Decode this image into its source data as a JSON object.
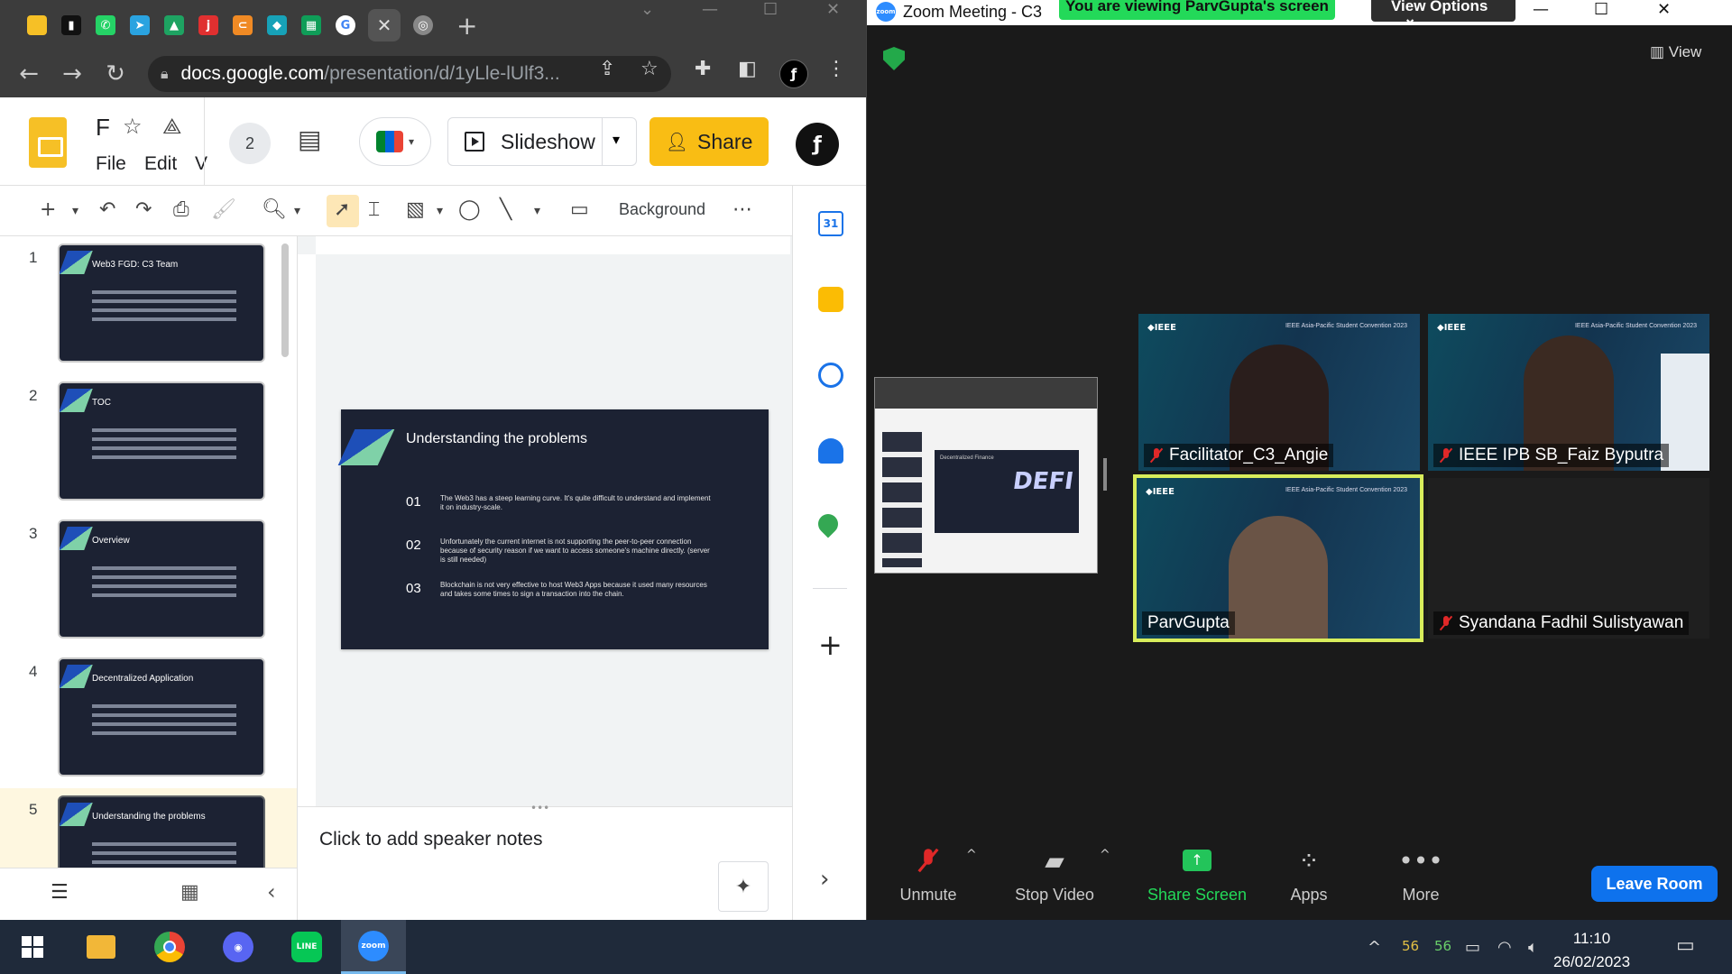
{
  "chrome": {
    "tabs": [
      {
        "icon": "keep-icon",
        "color": "#f6c026",
        "glyph": ""
      },
      {
        "icon": "trello-icon",
        "color": "#111111",
        "glyph": "▮"
      },
      {
        "icon": "whatsapp-icon",
        "color": "#25d366",
        "glyph": "✆"
      },
      {
        "icon": "telegram-icon",
        "color": "#2aa3e0",
        "glyph": "➤"
      },
      {
        "icon": "drive-icon",
        "color": "#1ea362",
        "glyph": "▲"
      },
      {
        "icon": "jira-icon",
        "color": "#e03030",
        "glyph": "j"
      },
      {
        "icon": "link-icon",
        "color": "#f08a24",
        "glyph": "⊂"
      },
      {
        "icon": "cube-icon",
        "color": "#17a2b8",
        "glyph": "◆"
      },
      {
        "icon": "sheets-icon",
        "color": "#0f9d58",
        "glyph": "▦"
      },
      {
        "icon": "google-icon",
        "color": "#ffffff",
        "glyph": "G"
      }
    ],
    "close_label": "✕",
    "newtab_label": "+",
    "url_host": "docs.google.com",
    "url_path": "/presentation/d/1yLle-lUlf3..."
  },
  "slides": {
    "doc_title": "F",
    "menu": [
      "File",
      "Edit",
      "V"
    ],
    "collaborators": "2",
    "slideshow_label": "Slideshow",
    "share_label": "Share",
    "toolbar_background": "Background",
    "thumbnails": [
      {
        "num": "1",
        "title": "Web3 FGD: C3 Team"
      },
      {
        "num": "2",
        "title": "TOC"
      },
      {
        "num": "3",
        "title": "Overview"
      },
      {
        "num": "4",
        "title": "Decentralized Application"
      },
      {
        "num": "5",
        "title": "Understanding the problems"
      }
    ],
    "current_slide": {
      "title": "Understanding the problems",
      "points": [
        {
          "num": "01",
          "text": "The Web3 has a steep learning curve. It's quite difficult to understand and implement it on industry-scale."
        },
        {
          "num": "02",
          "text": "Unfortunately the current internet is not supporting the peer-to-peer connection because of security reason if we want to access someone's machine directly. (server is still needed)"
        },
        {
          "num": "03",
          "text": "Blockchain is not very effective to host Web3 Apps because it used many resources and takes some times to sign a transaction into the chain."
        }
      ]
    },
    "speaker_notes_placeholder": "Click to add speaker notes"
  },
  "zoom": {
    "window_title": "Zoom Meeting - C3",
    "viewing_banner": "You are viewing ParvGupta's screen",
    "view_options": "View Options",
    "view_label": "View",
    "share_preview_text": "DEFI",
    "share_preview_heading": "Decentralized Finance",
    "participants": [
      {
        "name": "Facilitator_C3_Angie",
        "muted": true
      },
      {
        "name": "IEEE IPB SB_Faiz Byputra",
        "muted": true
      },
      {
        "name": "ParvGupta",
        "muted": false
      },
      {
        "name": "Syandana Fadhil Sulistyawan",
        "muted": true
      }
    ],
    "tile_ieee": "◆IEEE",
    "tile_conf": "IEEE Asia-Pacific Student Convention 2023",
    "controls": {
      "unmute": "Unmute",
      "stop_video": "Stop Video",
      "share_screen": "Share Screen",
      "apps": "Apps",
      "more": "More",
      "leave": "Leave Room"
    }
  },
  "taskbar": {
    "tray_num1": "56",
    "tray_num2": "56",
    "time": "11:10",
    "date": "26/02/2023",
    "zoom_label": "zoom"
  }
}
